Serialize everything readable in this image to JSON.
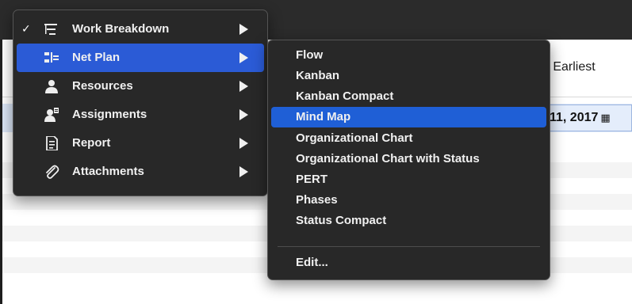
{
  "background": {
    "column_header": "n Earliest",
    "selected_date": "11, 2017",
    "calendar_icon": "calendar-icon"
  },
  "main_menu": {
    "items": [
      {
        "label": "Work Breakdown",
        "checked": true,
        "icon": "work-breakdown-icon",
        "has_submenu": true
      },
      {
        "label": "Net Plan",
        "checked": false,
        "icon": "net-plan-icon",
        "has_submenu": true,
        "highlighted": true
      },
      {
        "label": "Resources",
        "checked": false,
        "icon": "person-icon",
        "has_submenu": true
      },
      {
        "label": "Assignments",
        "checked": false,
        "icon": "assignment-icon",
        "has_submenu": true
      },
      {
        "label": "Report",
        "checked": false,
        "icon": "report-icon",
        "has_submenu": true
      },
      {
        "label": "Attachments",
        "checked": false,
        "icon": "paperclip-icon",
        "has_submenu": true
      }
    ]
  },
  "sub_menu": {
    "items": [
      {
        "label": "Flow"
      },
      {
        "label": "Kanban"
      },
      {
        "label": "Kanban Compact"
      },
      {
        "label": "Mind Map",
        "highlighted": true
      },
      {
        "label": "Organizational Chart"
      },
      {
        "label": "Organizational Chart with Status"
      },
      {
        "label": "PERT"
      },
      {
        "label": "Phases"
      },
      {
        "label": "Status Compact"
      }
    ],
    "edit_label": "Edit..."
  },
  "colors": {
    "menu_bg": "#282828",
    "highlight": "#2b5bd6",
    "selected_row": "#dbe6f7"
  }
}
